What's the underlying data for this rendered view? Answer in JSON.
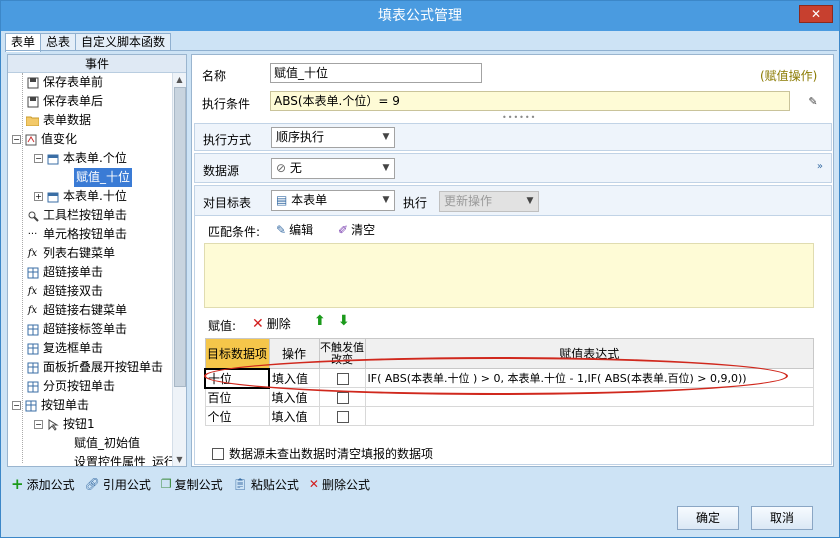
{
  "window": {
    "title": "填表公式管理",
    "close_label": "✕"
  },
  "tabs": [
    {
      "label": "表单"
    },
    {
      "label": "总表"
    },
    {
      "label": "自定义脚本函数"
    }
  ],
  "left": {
    "header": "事件",
    "items": [
      {
        "label": "保存表单前"
      },
      {
        "label": "保存表单后"
      },
      {
        "label": "表单数据"
      },
      {
        "label": "值变化"
      },
      {
        "label": "本表单.个位"
      },
      {
        "label": "赋值_十位"
      },
      {
        "label": "本表单.十位"
      },
      {
        "label": "工具栏按钮单击"
      },
      {
        "label": "单元格按钮单击"
      },
      {
        "label": "列表右键菜单"
      },
      {
        "label": "超链接单击"
      },
      {
        "label": "超链接双击"
      },
      {
        "label": "超链接右键菜单"
      },
      {
        "label": "超链接标签单击"
      },
      {
        "label": "复选框单击"
      },
      {
        "label": "面板折叠展开按钮单击"
      },
      {
        "label": "分页按钮单击"
      },
      {
        "label": "按钮单击"
      },
      {
        "label": "按钮1"
      },
      {
        "label": "赋值_初始值"
      },
      {
        "label": "设置控件属性_运行"
      }
    ]
  },
  "form": {
    "name_label": "名称",
    "name_value": "赋值_十位",
    "op_type": "(赋值操作)",
    "cond_label": "执行条件",
    "cond_value": "ABS(本表单.个位）= 9",
    "exec_mode_label": "执行方式",
    "exec_mode_value": "顺序执行",
    "datasource_label": "数据源",
    "datasource_value": "无",
    "target_label": "对目标表",
    "target_value": "本表单",
    "exec_label": "执行",
    "exec_value": "更新操作",
    "match_label": "匹配条件:",
    "edit_label": "编辑",
    "clear_label": "清空",
    "assign_label": "赋值:",
    "delete_label": "删除",
    "checkbox_label": "数据源未查出数据时清空填报的数据项"
  },
  "grid": {
    "headers": [
      "目标数据项",
      "操作",
      "不触发值改变",
      "赋值表达式"
    ],
    "rows": [
      {
        "target": "十位",
        "op": "填入值",
        "expr": "IF(  ABS(本表单.十位 ) > 0, 本表单.十位  - 1,IF(  ABS(本表单.百位)  > 0,9,0))"
      },
      {
        "target": "百位",
        "op": "填入值",
        "expr": ""
      },
      {
        "target": "个位",
        "op": "填入值",
        "expr": ""
      }
    ]
  },
  "bottom_toolbar": {
    "add": "添加公式",
    "ref": "引用公式",
    "copy": "复制公式",
    "paste": "粘贴公式",
    "delete": "删除公式"
  },
  "buttons": {
    "ok": "确定",
    "cancel": "取消"
  },
  "colors": {
    "title_bar": "#4a9be0",
    "selection": "#3a7bd5",
    "header_highlight": "#f5c64a",
    "annotation": "#d0281d"
  }
}
